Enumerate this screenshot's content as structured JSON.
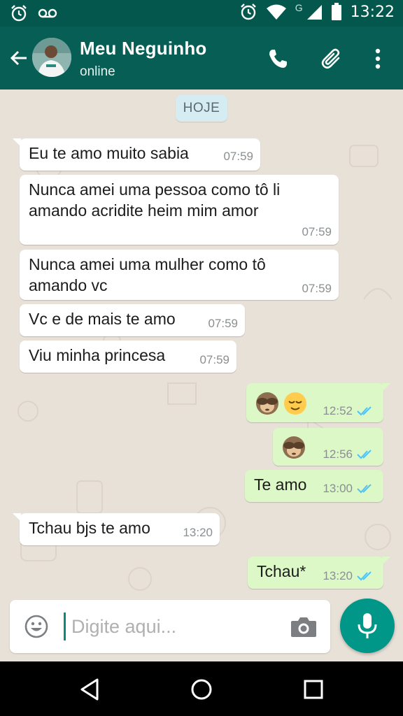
{
  "status_bar": {
    "time": "13:22",
    "network_label": "G",
    "icons": [
      "alarm-icon",
      "voicemail-icon",
      "alarm-icon",
      "wifi-icon",
      "signal-icon",
      "battery-icon"
    ]
  },
  "header": {
    "contact_name": "Meu Neguinho",
    "contact_status": "online",
    "icons": [
      "back-arrow-icon",
      "phone-icon",
      "paperclip-icon",
      "more-vertical-icon"
    ]
  },
  "chat": {
    "date_chip": "HOJE",
    "messages": [
      {
        "direction": "in",
        "lines": [
          "Eu te amo muito sabia"
        ],
        "time": "07:59"
      },
      {
        "direction": "in",
        "lines": [
          "Nunca amei uma pessoa como tô li",
          "amando acridite heim mim amor"
        ],
        "time": "07:59"
      },
      {
        "direction": "in",
        "lines": [
          "Nunca amei uma mulher como tô",
          "amando vc"
        ],
        "time": "07:59"
      },
      {
        "direction": "in",
        "lines": [
          "Vc e de mais te amo"
        ],
        "time": "07:59"
      },
      {
        "direction": "in",
        "lines": [
          "Viu minha princesa"
        ],
        "time": "07:59"
      },
      {
        "direction": "out",
        "emoji": [
          "see-no-evil-monkey",
          "relieved-face"
        ],
        "time": "12:52",
        "read": true
      },
      {
        "direction": "out",
        "emoji": [
          "see-no-evil-monkey"
        ],
        "time": "12:56",
        "read": true
      },
      {
        "direction": "out",
        "lines": [
          "Te amo"
        ],
        "time": "13:00",
        "read": true
      },
      {
        "direction": "in",
        "lines": [
          "Tchau bjs te amo"
        ],
        "time": "13:20"
      },
      {
        "direction": "out",
        "lines": [
          "Tchau*"
        ],
        "time": "13:20",
        "read": true
      }
    ]
  },
  "composer": {
    "placeholder": "Digite aqui...",
    "value": "",
    "icons": [
      "emoji-icon",
      "camera-icon",
      "mic-icon"
    ]
  },
  "nav": {
    "icons": [
      "back-triangle-icon",
      "home-circle-icon",
      "recents-square-icon"
    ]
  },
  "colors": {
    "status_bar": "#04574d",
    "app_bar": "#075e54",
    "chat_bg": "#e8e1d8",
    "incoming_bubble": "#ffffff",
    "outgoing_bubble": "#dcf8c6",
    "read_ticks": "#4fc3f7",
    "mic_button": "#009688"
  }
}
